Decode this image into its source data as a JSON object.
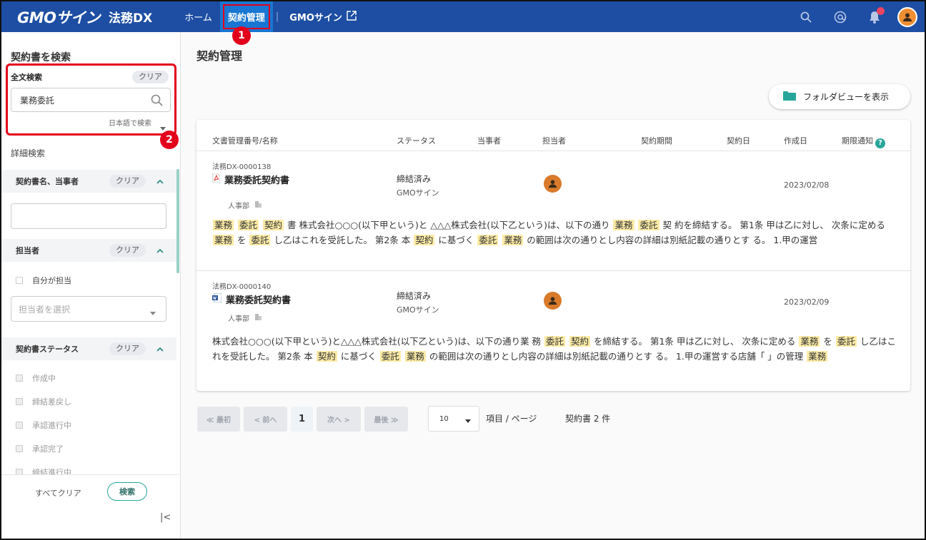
{
  "header": {
    "logo_brand": "GMOサイン",
    "logo_product": "法務DX",
    "nav": {
      "home": "ホーム",
      "contracts": "契約管理",
      "separator": "|",
      "gmo_sign": "GMOサイン"
    },
    "icons": [
      "search-icon",
      "mention-icon",
      "bell-icon",
      "avatar"
    ],
    "colors": {
      "bar": "#1d4ea3",
      "active": "#1976d2",
      "highlight_box": "#e3001b"
    }
  },
  "badges": {
    "one": "1",
    "two": "2"
  },
  "sidebar": {
    "title": "契約書を検索",
    "fulltext": {
      "label": "全文検索",
      "clear": "クリア",
      "value": "業務委託",
      "lang": "日本語で検索"
    },
    "detail_title": "詳細検索",
    "section_name": {
      "label": "契約書名、当事者",
      "clear": "クリア"
    },
    "section_person": {
      "label": "担当者",
      "clear": "クリア",
      "self_label": "自分が担当",
      "select_placeholder": "担当者を選択"
    },
    "section_status": {
      "label": "契約書ステータス",
      "clear": "クリア",
      "options": [
        "作成中",
        "締結差戻し",
        "承認進行中",
        "承認完了",
        "締結進行中"
      ]
    },
    "clear_all": "すべてクリア",
    "search_button": "検索",
    "collapse": "|<"
  },
  "main": {
    "title": "契約管理",
    "folder_view": "フォルダビューを表示",
    "columns": {
      "name": "文書管理番号/名称",
      "status": "ステータス",
      "party": "当事者",
      "assignee": "担当者",
      "period": "契約期間",
      "contract_date": "契約日",
      "created": "作成日",
      "notice": "期限通知",
      "notice_help": "?"
    },
    "rows": [
      {
        "doc_no": "法務DX-0000138",
        "name": "業務委託契約書",
        "file_type": "pdf",
        "dept": "人事部",
        "status": "締結済み",
        "party": "GMOサイン",
        "created": "2023/02/08",
        "excerpt": [
          {
            "h": "業務"
          },
          {
            "t": " "
          },
          {
            "h": "委託"
          },
          {
            "t": " "
          },
          {
            "h": "契約"
          },
          {
            "t": " 書 株式会社○○○(以下甲という)と △△△株式会社(以下乙という)は、以下の通り "
          },
          {
            "h": "業務"
          },
          {
            "t": " "
          },
          {
            "h": "委託"
          },
          {
            "t": " 契 約を締結する。 第1条 甲は乙に対し、 次条に定める "
          },
          {
            "h": "業務"
          },
          {
            "t": " を "
          },
          {
            "h": "委託"
          },
          {
            "t": " し乙はこれを受託した。 第2条 本 "
          },
          {
            "h": "契約"
          },
          {
            "t": " に基づく "
          },
          {
            "h": "委託"
          },
          {
            "t": " "
          },
          {
            "h": "業務"
          },
          {
            "t": " の範囲は次の通りとし内容の詳細は別紙記載の通りとす る。 1.甲の運営"
          }
        ]
      },
      {
        "doc_no": "法務DX-0000140",
        "name": "業務委託契約書",
        "file_type": "word",
        "dept": "人事部",
        "status": "締結済み",
        "party": "GMOサイン",
        "created": "2023/02/09",
        "excerpt": [
          {
            "t": "株式会社○○○(以下甲という)と△△△株式会社(以下乙という)は、以下の通り業 務 "
          },
          {
            "h": "委託"
          },
          {
            "t": " "
          },
          {
            "h": "契約"
          },
          {
            "t": " を締結する。 第1条 甲は乙に対し、 次条に定める "
          },
          {
            "h": "業務"
          },
          {
            "t": " を "
          },
          {
            "h": "委託"
          },
          {
            "t": " し乙はこれを受託した。 第2条 本 "
          },
          {
            "h": "契約"
          },
          {
            "t": " に基づく "
          },
          {
            "h": "委託"
          },
          {
            "t": " "
          },
          {
            "h": "業務"
          },
          {
            "t": " の範囲は次の通りとし内容の詳細は別紙記載の通りとす る。 1.甲の運営する店舗「 」の管理 "
          },
          {
            "h": "業務"
          }
        ]
      }
    ],
    "pager": {
      "first": "≪ 最初",
      "prev": "< 前へ",
      "current": "1",
      "next": "次へ >",
      "last": "最後 ≫",
      "per_page": "10",
      "per_page_label": "項目 / ページ",
      "count": "契約書 2 件"
    }
  }
}
